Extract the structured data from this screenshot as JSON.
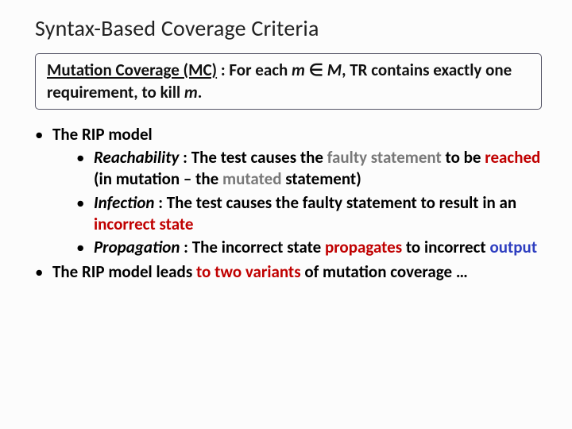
{
  "title": "Syntax-Based Coverage Criteria",
  "definition": {
    "label_uline": "Mutation Coverage (MC)",
    "sep": " : ",
    "lead": "For each ",
    "m1": "m",
    "in": " ∈ ",
    "M": "M",
    "mid": ", TR contains exactly one requirement, to kill ",
    "m2": "m",
    "end": "."
  },
  "b1": {
    "text": "The RIP model"
  },
  "r": {
    "name": "Reachability",
    "sep": " : ",
    "p1": "The test causes the ",
    "grey1": "faulty statement",
    "p2": " to be ",
    "red1": "reached",
    "p3": " (in mutation – the ",
    "grey2": "mutated",
    "p4": " statement)"
  },
  "i": {
    "name": "Infection",
    "sep": " : ",
    "p1": "The test causes the faulty statement to result in an ",
    "red1": "incorrect state"
  },
  "p": {
    "name": "Propagation",
    "sep": " : ",
    "p1": "The incorrect state ",
    "red1": "propagates",
    "p2": " to incorrect ",
    "blue1": "output"
  },
  "b2": {
    "p1": "The RIP model leads ",
    "red1": "to two variants",
    "p2": " of mutation coverage …"
  }
}
